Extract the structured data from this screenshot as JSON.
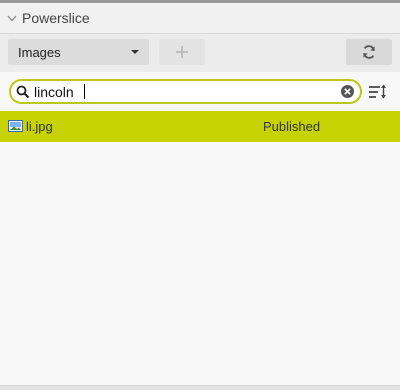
{
  "panel": {
    "title": "Powerslice"
  },
  "toolbar": {
    "type_select": {
      "value": "Images"
    },
    "add_icon": "plus-icon",
    "refresh_icon": "refresh-icon"
  },
  "search": {
    "value": "lincoln",
    "clear_icon": "clear-icon",
    "sort_icon": "sort-icon"
  },
  "results": [
    {
      "name": "li.jpg",
      "status": "Published",
      "icon": "image-file-icon"
    }
  ],
  "colors": {
    "accent": "#c6d300",
    "search_border": "#bcc81a"
  }
}
